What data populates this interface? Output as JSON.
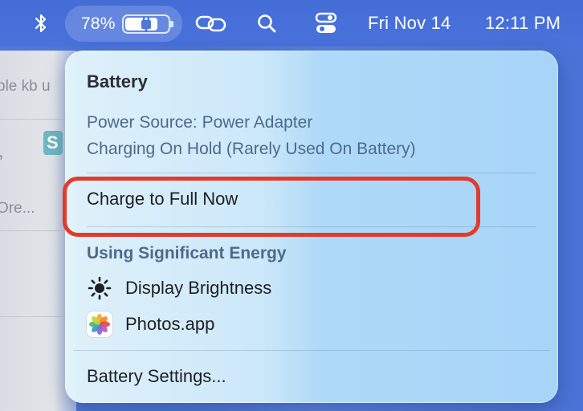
{
  "menu_bar": {
    "icons": [
      "bluetooth-icon",
      "link-icon",
      "search-icon",
      "control-center-icon"
    ],
    "battery": {
      "percent_label": "78%",
      "level": 0.78,
      "status": "charging-plug"
    },
    "date": "Fri Nov 14",
    "time": "12:11 PM"
  },
  "background_window": {
    "text_line_1": "ple kb u",
    "text_line_2": ",",
    "badge_letter": "S",
    "text_line_3": "Ore..."
  },
  "battery_menu": {
    "title": "Battery",
    "power_source": "Power Source: Power Adapter",
    "charging_status": "Charging On Hold (Rarely Used On Battery)",
    "charge_action": "Charge to Full Now",
    "energy_header": "Using Significant Energy",
    "energy_apps": [
      {
        "name": "Display Brightness",
        "icon": "sun-icon"
      },
      {
        "name": "Photos.app",
        "icon": "photos-app-icon"
      }
    ],
    "settings_link": "Battery Settings..."
  },
  "colors": {
    "highlight": "#e13b2b",
    "menubar": "#4a73d8"
  }
}
